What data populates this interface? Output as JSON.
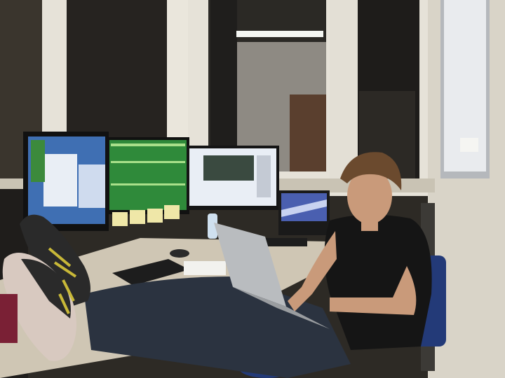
{
  "scene": {
    "description_label": "",
    "colors": {
      "wall_left": "#3a352d",
      "wall_right": "#d9d4c8",
      "window_frame": "#e6e2d8",
      "night_window": "#2a2824",
      "desk": "#cfc6b4",
      "monitor_bezel": "#111111",
      "screen_blue": "#3f6fb3",
      "screen_green": "#2f8a3a",
      "screen_white": "#e9eef5",
      "laptop_silver": "#b9bcbf",
      "shirt": "#151515",
      "jeans": "#2b3340",
      "skin": "#c99a7a",
      "hair": "#6b4a2e",
      "shoe": "#2a2a2a",
      "shoe_sole": "#d8c9c0",
      "laces": "#c8b838",
      "sticky_note": "#efe7a8",
      "whiteboard": "#e9ebee",
      "chair_blue": "#233a78"
    },
    "icons": [
      "ceiling-light-icon",
      "water-bottle-icon",
      "keyboard-icon",
      "mouse-icon"
    ]
  }
}
